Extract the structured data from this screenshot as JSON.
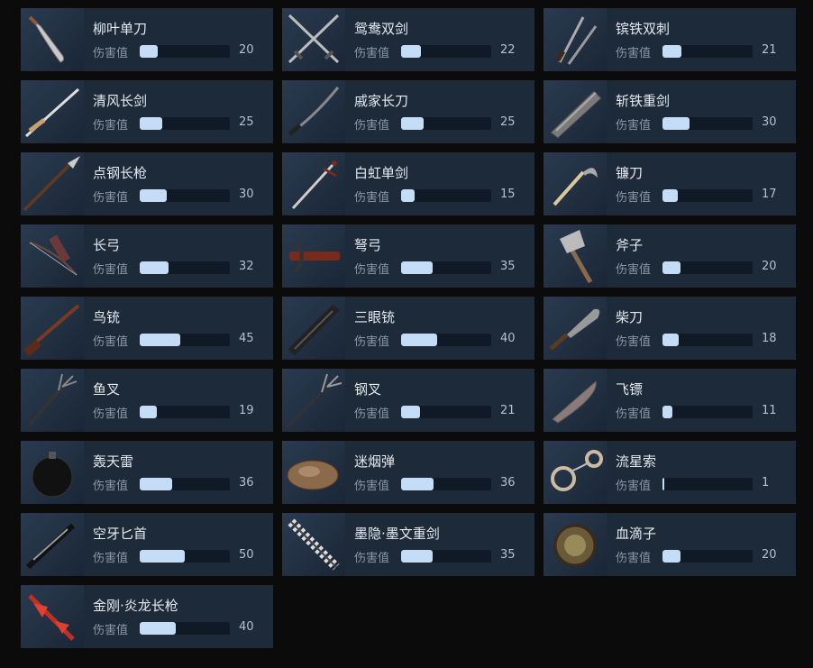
{
  "stat_label": "伤害值",
  "max_value": 100,
  "accent_color": "#c5dcf6",
  "card_color": "#1d2a39",
  "weapons": [
    {
      "name": "柳叶单刀",
      "value": 20,
      "icon": "saber-icon"
    },
    {
      "name": "鸳鸯双剑",
      "value": 22,
      "icon": "crossed-swords-icon"
    },
    {
      "name": "镔铁双刺",
      "value": 21,
      "icon": "twin-daggers-icon"
    },
    {
      "name": "清风长剑",
      "value": 25,
      "icon": "long-sword-icon"
    },
    {
      "name": "戚家长刀",
      "value": 25,
      "icon": "long-blade-icon"
    },
    {
      "name": "斩铁重剑",
      "value": 30,
      "icon": "heavy-sword-icon"
    },
    {
      "name": "点钢长枪",
      "value": 30,
      "icon": "spear-icon"
    },
    {
      "name": "白虹单剑",
      "value": 15,
      "icon": "sword-icon"
    },
    {
      "name": "镰刀",
      "value": 17,
      "icon": "sickle-icon"
    },
    {
      "name": "长弓",
      "value": 32,
      "icon": "bow-icon"
    },
    {
      "name": "弩弓",
      "value": 35,
      "icon": "crossbow-icon"
    },
    {
      "name": "斧子",
      "value": 20,
      "icon": "axe-icon"
    },
    {
      "name": "鸟铳",
      "value": 45,
      "icon": "musket-icon"
    },
    {
      "name": "三眼铳",
      "value": 40,
      "icon": "triple-barrel-gun-icon"
    },
    {
      "name": "柴刀",
      "value": 18,
      "icon": "machete-icon"
    },
    {
      "name": "鱼叉",
      "value": 19,
      "icon": "fish-fork-icon"
    },
    {
      "name": "钢叉",
      "value": 21,
      "icon": "trident-icon"
    },
    {
      "name": "飞镖",
      "value": 11,
      "icon": "dart-blade-icon"
    },
    {
      "name": "轰天雷",
      "value": 36,
      "icon": "bomb-icon"
    },
    {
      "name": "迷烟弹",
      "value": 36,
      "icon": "smoke-bomb-icon"
    },
    {
      "name": "流星索",
      "value": 1,
      "icon": "meteor-rope-icon"
    },
    {
      "name": "空牙匕首",
      "value": 50,
      "icon": "dagger-icon"
    },
    {
      "name": "墨隐·墨文重剑",
      "value": 35,
      "icon": "wrapped-greatsword-icon"
    },
    {
      "name": "血滴子",
      "value": 20,
      "icon": "blood-drop-icon"
    },
    {
      "name": "金刚·炎龙长枪",
      "value": 40,
      "icon": "flame-dragon-spear-icon"
    }
  ]
}
